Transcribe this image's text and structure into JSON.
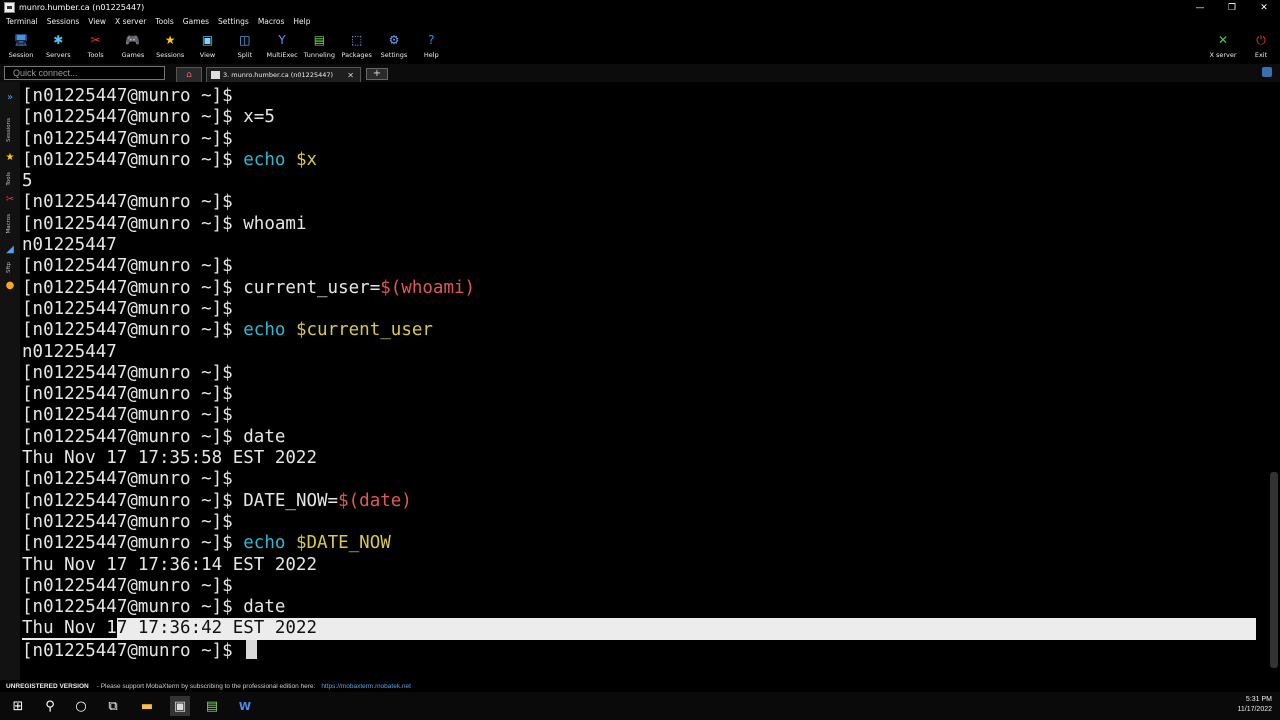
{
  "window": {
    "title": "munro.humber.ca (n01225447)",
    "controls": [
      "—",
      "❐",
      "✕"
    ]
  },
  "menu": [
    "Terminal",
    "Sessions",
    "View",
    "X server",
    "Tools",
    "Games",
    "Settings",
    "Macros",
    "Help"
  ],
  "toolbar": {
    "left": [
      {
        "label": "Session",
        "icon": "session-icon",
        "glyph": "🖥",
        "color": "#4a90e2"
      },
      {
        "label": "Servers",
        "icon": "servers-icon",
        "glyph": "✱",
        "color": "#4fc3f7"
      },
      {
        "label": "Tools",
        "icon": "tools-icon",
        "glyph": "✂",
        "color": "#e53935"
      },
      {
        "label": "Games",
        "icon": "games-icon",
        "glyph": "🎮",
        "color": "#bbbbbb"
      },
      {
        "label": "Sessions",
        "icon": "star-icon",
        "glyph": "★",
        "color": "#ffcc00"
      },
      {
        "label": "View",
        "icon": "view-icon",
        "glyph": "▣",
        "color": "#7fd3ff"
      },
      {
        "label": "Split",
        "icon": "split-icon",
        "glyph": "◫",
        "color": "#66b3ff"
      },
      {
        "label": "MultiExec",
        "icon": "multiexec-icon",
        "glyph": "Y",
        "color": "#6f8cff"
      },
      {
        "label": "Tunneling",
        "icon": "tunneling-icon",
        "glyph": "▤",
        "color": "#7ed957"
      },
      {
        "label": "Packages",
        "icon": "packages-icon",
        "glyph": "⬚",
        "color": "#9aa6ff"
      },
      {
        "label": "Settings",
        "icon": "settings-icon",
        "glyph": "⚙",
        "color": "#66a6ff"
      },
      {
        "label": "Help",
        "icon": "help-icon",
        "glyph": "?",
        "color": "#2196f3"
      }
    ],
    "right": [
      {
        "label": "X server",
        "icon": "xserver-icon",
        "glyph": "✕",
        "color": "#5ec15e"
      },
      {
        "label": "Exit",
        "icon": "power-icon",
        "glyph": "⏻",
        "color": "#e53935"
      }
    ]
  },
  "tabs": {
    "quick_connect_placeholder": "Quick connect...",
    "home_glyph": "⌂",
    "active_tab": "3. munro.humber.ca (n01225447)",
    "close_glyph": "✕",
    "new_tab_glyph": "+"
  },
  "sidebar": {
    "tabs": [
      "Sessions",
      "Tools",
      "Macros",
      "Sftp"
    ]
  },
  "terminal": {
    "prompt": "[n01225447@munro ~]$ ",
    "lines": [
      {
        "type": "prompt",
        "cmd": "",
        "args": []
      },
      {
        "type": "prompt",
        "cmd": "x=5",
        "args": []
      },
      {
        "type": "prompt",
        "cmd": "",
        "args": []
      },
      {
        "type": "prompt",
        "cmd": "echo",
        "cmdcolor": "cmd",
        "args": [
          {
            "t": " ",
            "c": ""
          },
          {
            "t": "$x",
            "c": "var"
          }
        ]
      },
      {
        "type": "output",
        "text": "5"
      },
      {
        "type": "prompt",
        "cmd": "",
        "args": []
      },
      {
        "type": "prompt",
        "cmd": "whoami",
        "args": []
      },
      {
        "type": "output",
        "text": "n01225447"
      },
      {
        "type": "prompt",
        "cmd": "",
        "args": []
      },
      {
        "type": "prompt",
        "cmd": "current_user=",
        "args": [
          {
            "t": "$(whoami)",
            "c": "sub"
          }
        ]
      },
      {
        "type": "prompt",
        "cmd": "",
        "args": []
      },
      {
        "type": "prompt",
        "cmd": "echo",
        "cmdcolor": "cmd",
        "args": [
          {
            "t": " ",
            "c": ""
          },
          {
            "t": "$current_user",
            "c": "var"
          }
        ]
      },
      {
        "type": "output",
        "text": "n01225447"
      },
      {
        "type": "prompt",
        "cmd": "",
        "args": []
      },
      {
        "type": "prompt",
        "cmd": "",
        "args": []
      },
      {
        "type": "prompt",
        "cmd": "",
        "args": []
      },
      {
        "type": "prompt",
        "cmd": "date",
        "args": []
      },
      {
        "type": "output",
        "text": "Thu Nov 17 17:35:58 EST 2022"
      },
      {
        "type": "prompt",
        "cmd": "",
        "args": []
      },
      {
        "type": "prompt",
        "cmd": "DATE_NOW=",
        "args": [
          {
            "t": "$(date)",
            "c": "sub"
          }
        ]
      },
      {
        "type": "prompt",
        "cmd": "",
        "args": []
      },
      {
        "type": "prompt",
        "cmd": "echo",
        "cmdcolor": "cmd",
        "args": [
          {
            "t": " ",
            "c": ""
          },
          {
            "t": "$DATE_NOW",
            "c": "var"
          }
        ]
      },
      {
        "type": "output",
        "text": "Thu Nov 17 17:36:14 EST 2022"
      },
      {
        "type": "prompt",
        "cmd": "",
        "args": []
      },
      {
        "type": "prompt",
        "cmd": "date",
        "args": []
      },
      {
        "type": "selected",
        "pre": "Thu Nov 1",
        "text": "7 17:36:42 EST 2022"
      },
      {
        "type": "cursor"
      }
    ]
  },
  "status": {
    "unregistered": "UNREGISTERED VERSION",
    "message": "-  Please support MobaXterm by subscribing to the professional edition here:",
    "link": "https://mobaxterm.mobatek.net"
  },
  "taskbar": {
    "time": "5:31 PM",
    "date": "11/17/2022"
  },
  "colors": {
    "command": "#2fb8d4",
    "variable": "#d9c84a",
    "substitution": "#e05a4f"
  }
}
